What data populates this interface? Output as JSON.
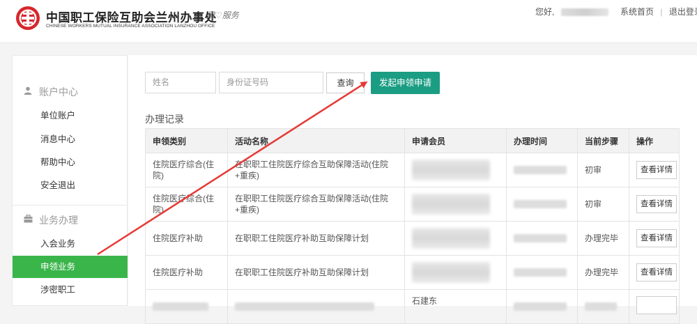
{
  "header": {
    "title": "中国职工保险互助会兰州办事处",
    "subtitle": "CHINESE WORKERS MUTUAL INSURANCE ASSOCIATION LANZHOU OFFICE",
    "slogan": "用♡服务",
    "greeting": "您好,",
    "home_link": "系统首页",
    "logout_link": "退出登录"
  },
  "sidebar": {
    "sections": [
      {
        "title": "账户中心",
        "icon": "user-icon",
        "items": [
          "单位账户",
          "消息中心",
          "帮助中心",
          "安全退出"
        ]
      },
      {
        "title": "业务办理",
        "icon": "briefcase-icon",
        "items": [
          "入会业务",
          "申领业务",
          "涉密职工"
        ]
      }
    ],
    "active_item": "申领业务"
  },
  "search": {
    "name_placeholder": "姓名",
    "id_placeholder": "身份证号码",
    "query_label": "查询",
    "apply_label": "发起申领申请"
  },
  "records": {
    "title": "办理记录",
    "columns": [
      "申领类别",
      "活动名称",
      "申请会员",
      "办理时间",
      "当前步骤",
      "操作"
    ],
    "rows": [
      {
        "category": "住院医疗综合(住院)",
        "activity": "在职职工住院医疗综合互助保障活动(住院+重疾)",
        "step": "初审",
        "step_color": "#e03a2f",
        "action": "查看详情"
      },
      {
        "category": "住院医疗综合(住院)",
        "activity": "在职职工住院医疗综合互助保障活动(住院+重疾)",
        "step": "初审",
        "step_color": "#e03a2f",
        "action": "查看详情"
      },
      {
        "category": "住院医疗补助",
        "activity": "在职职工住院医疗补助互助保障计划",
        "step": "办理完毕",
        "step_color": "#2f9a3a",
        "action": "查看详情"
      },
      {
        "category": "住院医疗补助",
        "activity": "在职职工住院医疗补助互助保障计划",
        "step": "办理完毕",
        "step_color": "#2f9a3a",
        "action": "查看详情"
      },
      {
        "category": "",
        "activity": "",
        "member": "石建东",
        "step": "",
        "step_color": "#2f9a3a",
        "action": ""
      }
    ]
  },
  "colors": {
    "brand_red": "#d7262b",
    "accent_green": "#3ab54a",
    "apply_teal": "#1b9d83",
    "annotation_arrow": "#e53935"
  }
}
